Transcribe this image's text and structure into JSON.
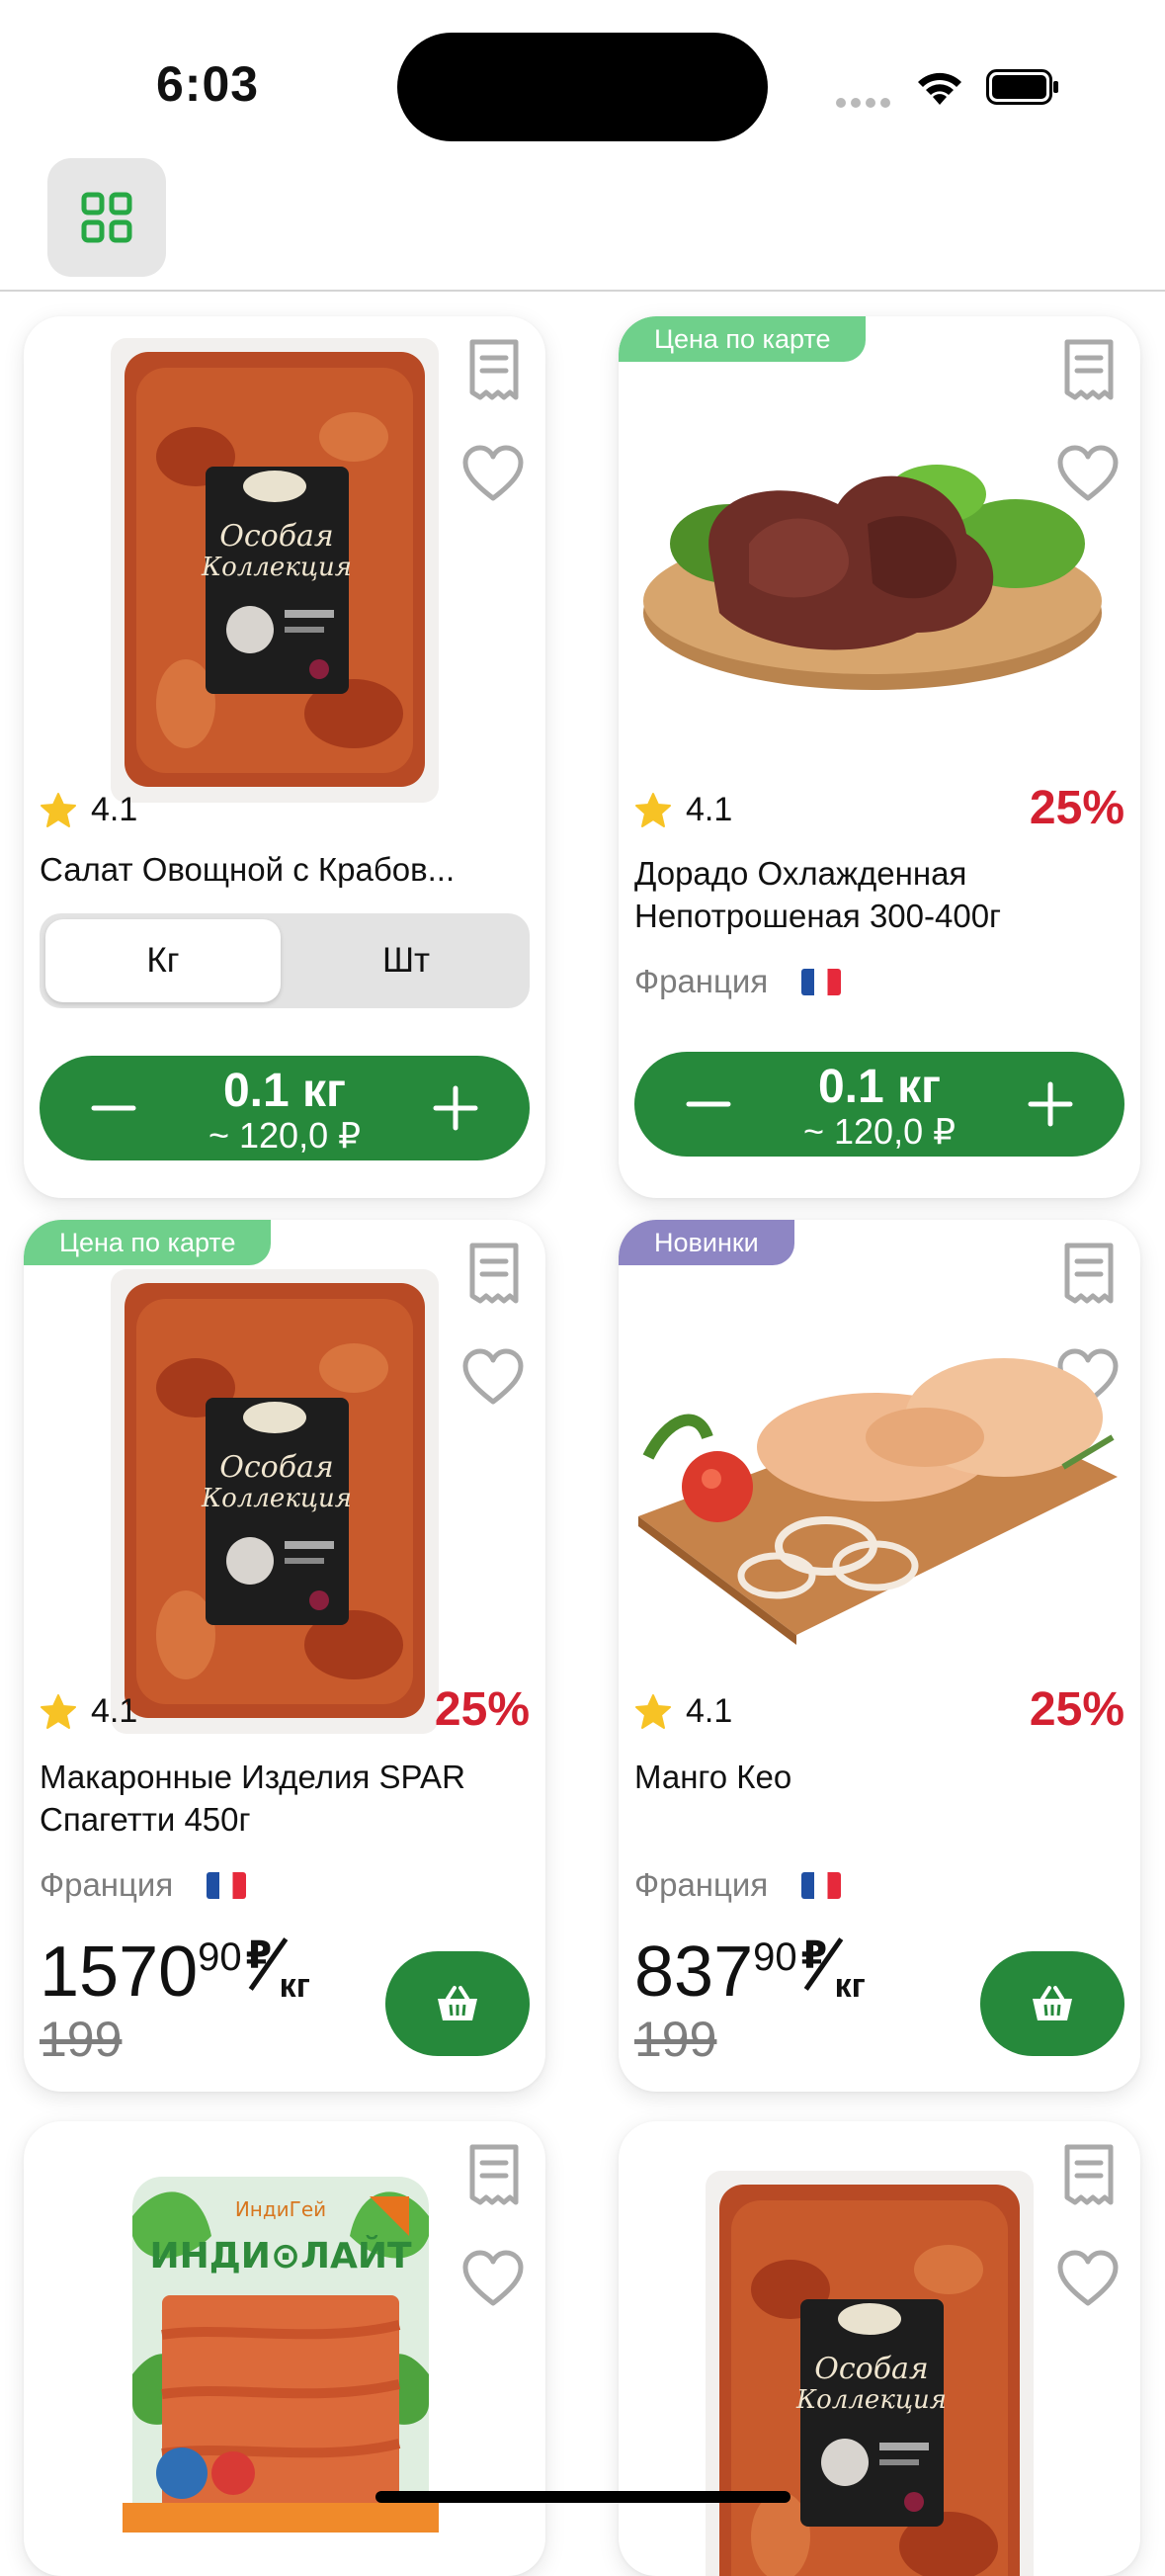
{
  "status": {
    "time": "6:03"
  },
  "colors": {
    "accent_green": "#26893b",
    "discount_red": "#d32030",
    "badge_green": "#6fd08b",
    "badge_purple": "#8e86c4"
  },
  "products": [
    {
      "badge": "",
      "rating": "4.1",
      "discount": "",
      "name": "Салат Овощной с Крабов...",
      "country": "",
      "segment": {
        "selected": "Кг",
        "other": "Шт"
      },
      "qty": {
        "amount": "0.1 кг",
        "approx": "~ 120,0 ₽"
      },
      "image": "marinated-meat-pack"
    },
    {
      "badge": "Цена по карте",
      "rating": "4.1",
      "discount": "25%",
      "name": "Дорадо Охлажденная Непотрошеная 300-400г",
      "country": "Франция",
      "qty": {
        "amount": "0.1 кг",
        "approx": "~ 120,0 ₽"
      },
      "image": "grilled-steak-board"
    },
    {
      "badge": "Цена по карте",
      "rating": "4.1",
      "discount": "25%",
      "name": "Макаронные Изделия SPAR Спагетти 450г",
      "country": "Франция",
      "price": {
        "main": "1570",
        "fraction": "90",
        "currency": "₽",
        "unit": "кг",
        "old": "199"
      },
      "image": "marinated-meat-pack"
    },
    {
      "badge": "Новинки",
      "rating": "4.1",
      "discount": "25%",
      "name": "Манго Кео",
      "country": "Франция",
      "price": {
        "main": "837",
        "fraction": "90",
        "currency": "₽",
        "unit": "кг",
        "old": "199"
      },
      "image": "chicken-board"
    },
    {
      "badge": "",
      "image": "indilait-pack"
    },
    {
      "badge": "",
      "image": "marinated-meat-pack"
    }
  ]
}
